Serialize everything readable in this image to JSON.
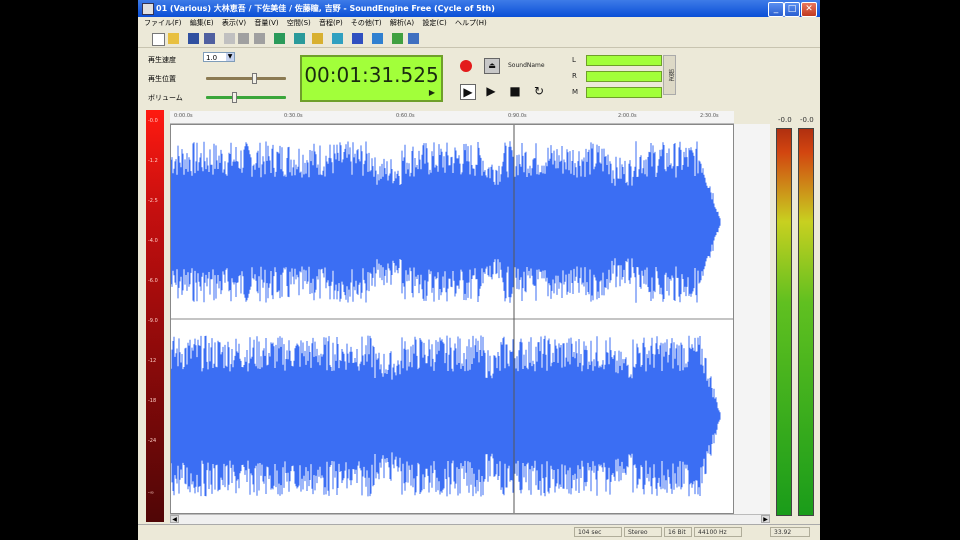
{
  "window": {
    "title": "01 (Various) 大林恵吾 / 下佐美佳 / 佐藤瞳, 吉野 - SoundEngine Free (Cycle of 5th)",
    "minimize": "_",
    "maximize": "□",
    "close": "✕"
  },
  "menu": [
    "ファイル(F)",
    "編集(E)",
    "表示(V)",
    "音量(V)",
    "空間(S)",
    "音程(P)",
    "その他(T)",
    "解析(A)",
    "設定(C)",
    "ヘルプ(H)"
  ],
  "controls": {
    "speed_label": "再生速度",
    "speed_value": "1.0",
    "position_label": "再生位置",
    "volume_label": "ボリューム",
    "position_level": 0.6,
    "volume_level": 0.35
  },
  "lcd": {
    "time": "00:01:31.525",
    "arrow": "▶"
  },
  "transport": {
    "send_label": "SoundName",
    "play": "▶",
    "stop": "■",
    "loop": "↻",
    "meters": [
      {
        "label": "L"
      },
      {
        "label": "R"
      },
      {
        "label": "M"
      }
    ],
    "side_button": "設定"
  },
  "ruler": [
    "0:00.0s",
    "0:30.0s",
    "0:60.0s",
    "0:90.0s",
    "2:00.0s",
    "2:30.0s"
  ],
  "db_scale": [
    "-0.0",
    "-1.2",
    "-2.5",
    "-4.0",
    "-6.0",
    "-9.0",
    "-12",
    "-18",
    "-24",
    "-∞"
  ],
  "vu": {
    "left_top": "-0.0",
    "right_top": "-0.0"
  },
  "status": [
    "104 sec",
    "Stereo",
    "16 Bit",
    "44100 Hz",
    "33.92"
  ],
  "colors": {
    "wave": "#3b6ef3",
    "lcd": "#a2ff3a",
    "title": "#0a4fd6"
  }
}
